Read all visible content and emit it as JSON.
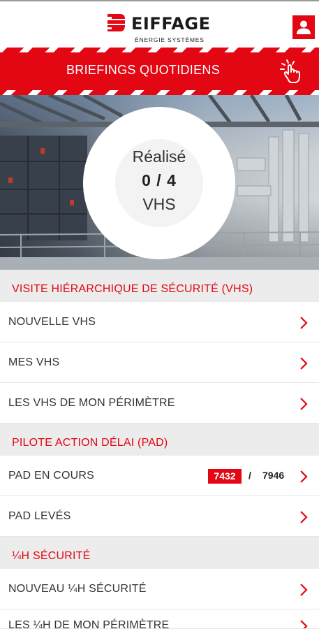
{
  "header": {
    "brand_name": "EIFFAGE",
    "brand_subtitle": "ÉNERGIE SYSTÈMES",
    "profile_icon": "user-icon"
  },
  "banner": {
    "title": "BRIEFINGS QUOTIDIENS",
    "icon": "tap-hand-icon"
  },
  "hero": {
    "label": "Réalisé",
    "value": "0 / 4",
    "unit": "VHS"
  },
  "sections": {
    "vhs": {
      "title": "VISITE HIÉRARCHIQUE DE SÉCURITÉ (VHS)",
      "items": [
        "NOUVELLE VHS",
        "MES VHS",
        "LES VHS DE MON PÉRIMÈTRE"
      ]
    },
    "pad": {
      "title": "PILOTE ACTION DÉLAI (PAD)",
      "items": [
        "PAD EN COURS",
        "PAD LEVÉS"
      ],
      "in_progress_count": "7432",
      "separator": "/",
      "total_count": "7946"
    },
    "quart": {
      "title": "¼H SÉCURITÉ",
      "items": [
        "NOUVEAU ¼H SÉCURITÉ",
        "LES ¼H DE MON PÉRIMÈTRE"
      ]
    }
  },
  "colors": {
    "brand_red": "#e30613",
    "section_bg": "#ececec",
    "text": "#333333"
  }
}
